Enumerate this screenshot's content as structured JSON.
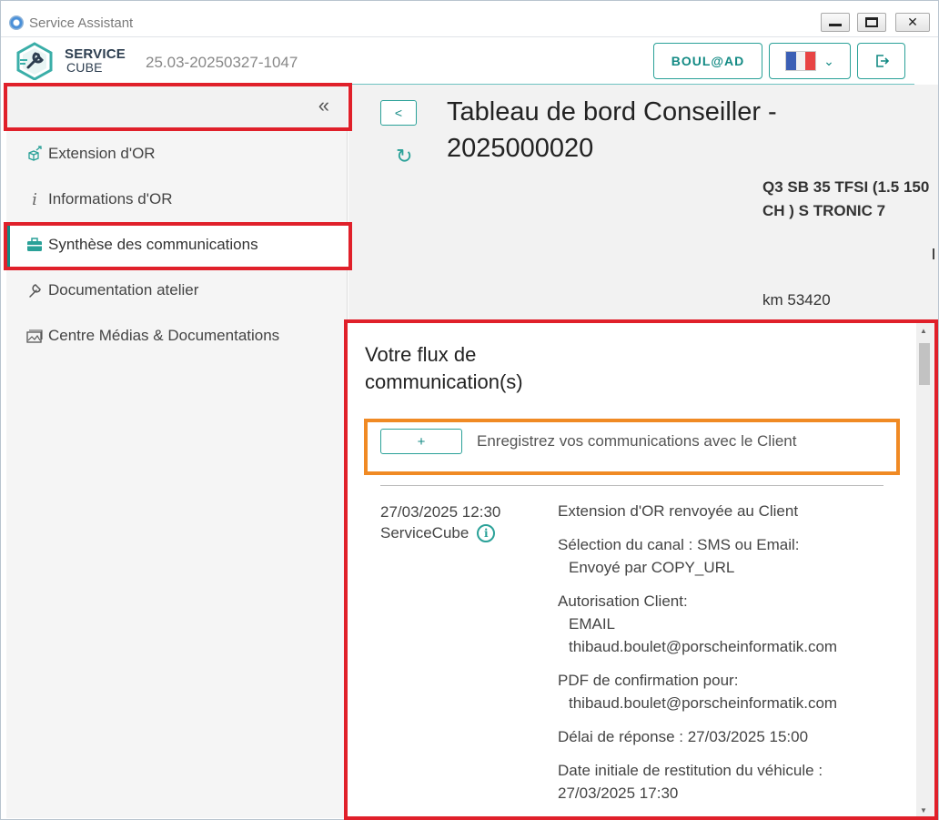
{
  "window": {
    "title": "Service Assistant"
  },
  "header": {
    "logo_line1": "SERVICE",
    "logo_line2": "CUBE",
    "version": "25.03-20250327-1047",
    "user_button": "BOUL@AD"
  },
  "sidebar": {
    "items": [
      {
        "label": "Extension d'OR",
        "icon": "cube-arrow-icon"
      },
      {
        "label": "Informations d'OR",
        "icon": "info-icon"
      },
      {
        "label": "Synthèse des communications",
        "icon": "briefcase-icon",
        "active": true
      },
      {
        "label": "Documentation atelier",
        "icon": "wrench-icon"
      },
      {
        "label": "Centre Médias & Documentations",
        "icon": "image-stack-icon"
      }
    ]
  },
  "main": {
    "back_label": "<",
    "title": "Tableau de bord Conseiller - 2025000020",
    "vehicle": "Q3 SB 35 TFSI (1.5 150 CH ) S TRONIC 7",
    "km": "km 53420"
  },
  "flow": {
    "title_line1": "Votre flux de",
    "title_line2": "communication(s)",
    "add_button": "+",
    "add_label": "Enregistrez vos communications avec le Client",
    "entry": {
      "date": "27/03/2025 12:30",
      "source": "ServiceCube",
      "headline": "Extension d'OR renvoyée au Client",
      "channel_label": "Sélection du canal : SMS ou Email:",
      "channel_value": "Envoyé par COPY_URL",
      "auth_label": "Autorisation Client:",
      "auth_type": "EMAIL",
      "auth_email": "thibaud.boulet@porscheinformatik.com",
      "pdf_label": "PDF de confirmation pour:",
      "pdf_email": "thibaud.boulet@porscheinformatik.com",
      "delay": "Délai de réponse : 27/03/2025 15:00",
      "return_label": "Date initiale de restitution du véhicule :",
      "return_value": "27/03/2025 17:30"
    }
  },
  "colors": {
    "accent": "#138a84",
    "highlight_red": "#e0202a",
    "highlight_orange": "#f08a24"
  }
}
